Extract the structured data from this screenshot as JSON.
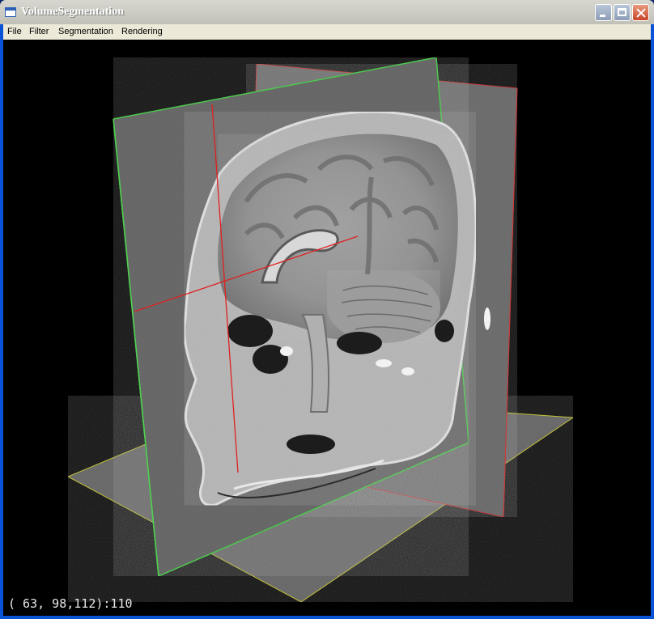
{
  "window": {
    "title": "VolumeSegmentation",
    "app_icon": "window-icon",
    "buttons": {
      "minimize": "minimize-icon",
      "maximize": "maximize-icon",
      "close": "close-icon"
    }
  },
  "menu": {
    "items": [
      {
        "label": "File"
      },
      {
        "label": "Filter"
      },
      {
        "label": "Segmentation"
      },
      {
        "label": "Rendering"
      }
    ]
  },
  "viewport": {
    "scene": "mri-head-orthogonal-slices",
    "slice_colors": {
      "sagittal": "#4fd14f",
      "coronal": "#d03a3a",
      "axial": "#c8c83a"
    },
    "background": "#000000"
  },
  "status": {
    "coordinates": "( 63, 98,112):110"
  }
}
